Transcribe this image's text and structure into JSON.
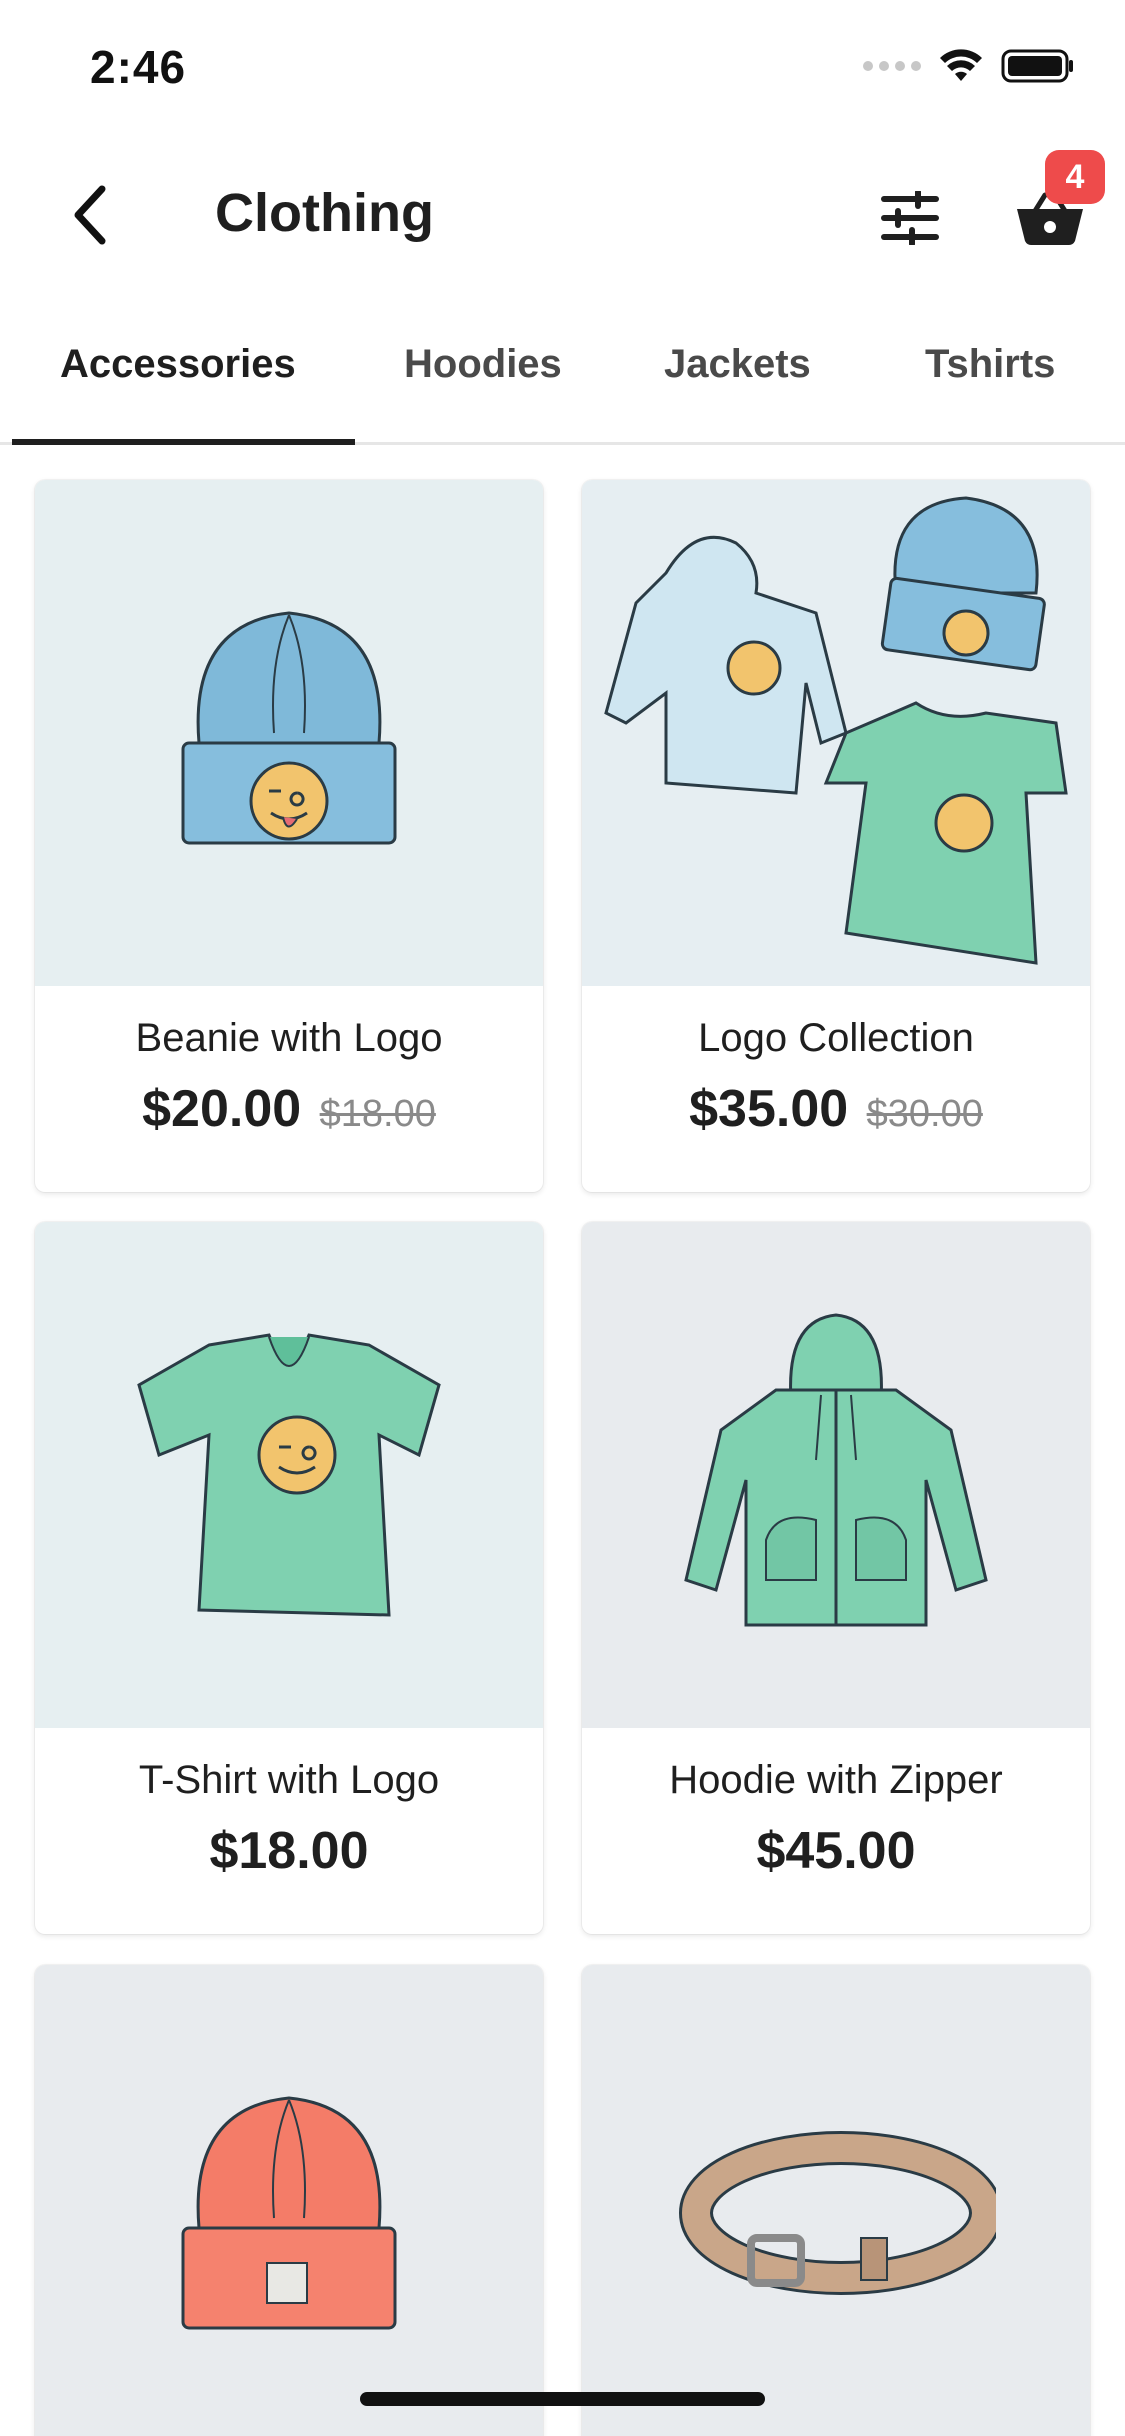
{
  "status_bar": {
    "time": "2:46"
  },
  "header": {
    "title": "Clothing",
    "cart_count": "4"
  },
  "tabs": [
    {
      "label": "Accessories",
      "active": true
    },
    {
      "label": "Hoodies",
      "active": false
    },
    {
      "label": "Jackets",
      "active": false
    },
    {
      "label": "Tshirts",
      "active": false
    }
  ],
  "products": [
    {
      "name": "Beanie with Logo",
      "price": "$20.00",
      "old_price": "$18.00",
      "icon": "beanie-blue-logo"
    },
    {
      "name": "Logo Collection",
      "price": "$35.00",
      "old_price": "$30.00",
      "icon": "logo-collection"
    },
    {
      "name": "T-Shirt with Logo",
      "price": "$18.00",
      "old_price": "",
      "icon": "tshirt-green-logo"
    },
    {
      "name": "Hoodie with Zipper",
      "price": "$45.00",
      "old_price": "",
      "icon": "hoodie-zipper"
    },
    {
      "name": "",
      "price": "",
      "old_price": "",
      "icon": "beanie-orange"
    },
    {
      "name": "",
      "price": "",
      "old_price": "",
      "icon": "belt"
    }
  ],
  "colors": {
    "accent_dark": "#1f1f1f",
    "badge": "#ee4b4b",
    "card_bg_light": "#e6eff1",
    "card_bg_gray": "#e8ebee"
  }
}
